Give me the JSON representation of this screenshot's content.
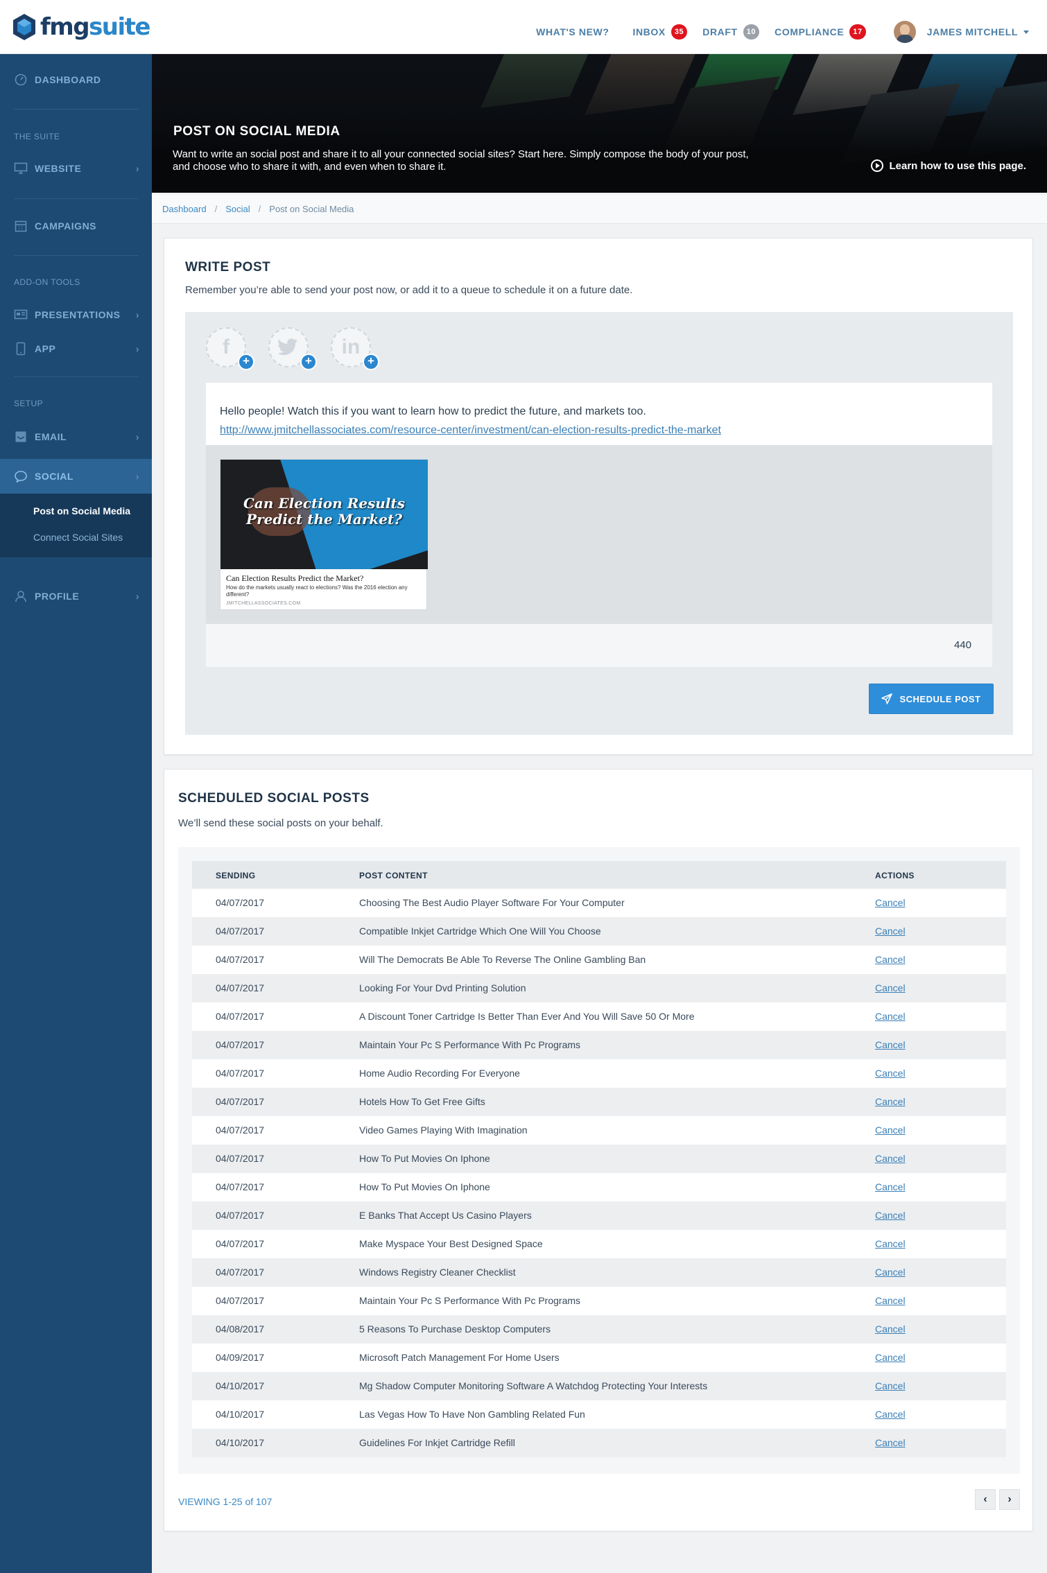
{
  "brand": {
    "name_part1": "fmg",
    "name_part2": "suite"
  },
  "topnav": {
    "whats_new": "WHAT'S NEW?",
    "inbox": "INBOX",
    "inbox_count": "35",
    "draft": "DRAFT",
    "draft_count": "10",
    "compliance": "COMPLIANCE",
    "compliance_count": "17",
    "user": "JAMES MITCHELL"
  },
  "sidebar": {
    "dashboard": "DASHBOARD",
    "heading_suite": "THE SUITE",
    "website": "WEBSITE",
    "campaigns": "CAMPAIGNS",
    "heading_addons": "ADD-ON TOOLS",
    "presentations": "PRESENTATIONS",
    "app": "APP",
    "heading_setup": "SETUP",
    "email": "EMAIL",
    "social": "SOCIAL",
    "sub_post": "Post on Social Media",
    "sub_connect": "Connect Social Sites",
    "profile": "PROFILE"
  },
  "hero": {
    "title": "POST ON SOCIAL MEDIA",
    "description": "Want to write an social post and share it to all your connected social sites? Start here. Simply compose the body of your post, and choose who to share it with, and even when to share it.",
    "learn": "Learn how to use this page."
  },
  "breadcrumb": [
    "Dashboard",
    "Social",
    "Post on Social Media"
  ],
  "write_post": {
    "title": "WRITE POST",
    "subtitle": "Remember you’re able to send your post now, or add it to a queue to schedule it on a future date.",
    "social_icons": [
      "f",
      "t",
      "in"
    ],
    "text": "Hello people! Watch this if you want to learn how to predict the future, and markets too.",
    "link": "http://www.jmitchellassociates.com/resource-center/investment/can-election-results-predict-the-market",
    "preview": {
      "image_title": "Can Election Results Predict the Market?",
      "headline": "Can Election Results Predict the Market?",
      "description": "How do the markets usually react to elections? Was the 2016 election any different?",
      "domain": "JMITCHELLASSOCIATES.COM"
    },
    "char_count": "440",
    "schedule_label": "SCHEDULE POST"
  },
  "scheduled": {
    "title": "SCHEDULED SOCIAL POSTS",
    "subtitle": "We’ll send these social posts on your behalf.",
    "columns": [
      "SENDING",
      "POST CONTENT",
      "ACTIONS"
    ],
    "rows": [
      {
        "date": "04/07/2017",
        "content": "Choosing The Best Audio Player Software For Your Computer",
        "action": "Cancel"
      },
      {
        "date": "04/07/2017",
        "content": "Compatible Inkjet Cartridge Which One Will You Choose",
        "action": "Cancel"
      },
      {
        "date": "04/07/2017",
        "content": "Will The Democrats Be Able To Reverse The Online Gambling Ban",
        "action": "Cancel"
      },
      {
        "date": "04/07/2017",
        "content": "Looking For Your Dvd Printing Solution",
        "action": "Cancel"
      },
      {
        "date": "04/07/2017",
        "content": "A Discount Toner Cartridge Is Better Than Ever And You Will Save 50 Or More",
        "action": "Cancel"
      },
      {
        "date": "04/07/2017",
        "content": "Maintain Your Pc S Performance With Pc Programs",
        "action": "Cancel"
      },
      {
        "date": "04/07/2017",
        "content": "Home Audio Recording For Everyone",
        "action": "Cancel"
      },
      {
        "date": "04/07/2017",
        "content": "Hotels How To Get Free Gifts",
        "action": "Cancel"
      },
      {
        "date": "04/07/2017",
        "content": "Video Games Playing With Imagination",
        "action": "Cancel"
      },
      {
        "date": "04/07/2017",
        "content": "How To Put Movies On Iphone",
        "action": "Cancel"
      },
      {
        "date": "04/07/2017",
        "content": "How To Put Movies On Iphone",
        "action": "Cancel"
      },
      {
        "date": "04/07/2017",
        "content": "E Banks That Accept Us Casino Players",
        "action": "Cancel"
      },
      {
        "date": "04/07/2017",
        "content": "Make Myspace Your Best Designed Space",
        "action": "Cancel"
      },
      {
        "date": "04/07/2017",
        "content": "Windows Registry Cleaner Checklist",
        "action": "Cancel"
      },
      {
        "date": "04/07/2017",
        "content": "Maintain Your Pc S Performance With Pc Programs",
        "action": "Cancel"
      },
      {
        "date": "04/08/2017",
        "content": "5 Reasons To Purchase Desktop Computers",
        "action": "Cancel"
      },
      {
        "date": "04/09/2017",
        "content": "Microsoft Patch Management For Home Users",
        "action": "Cancel"
      },
      {
        "date": "04/10/2017",
        "content": "Mg Shadow Computer Monitoring Software A Watchdog Protecting Your Interests",
        "action": "Cancel"
      },
      {
        "date": "04/10/2017",
        "content": "Las Vegas How To Have Non Gambling Related Fun",
        "action": "Cancel"
      },
      {
        "date": "04/10/2017",
        "content": "Guidelines For Inkjet Cartridge Refill",
        "action": "Cancel"
      }
    ],
    "viewing": "VIEWING 1-25 of 107",
    "prev": "‹",
    "next": "›"
  }
}
